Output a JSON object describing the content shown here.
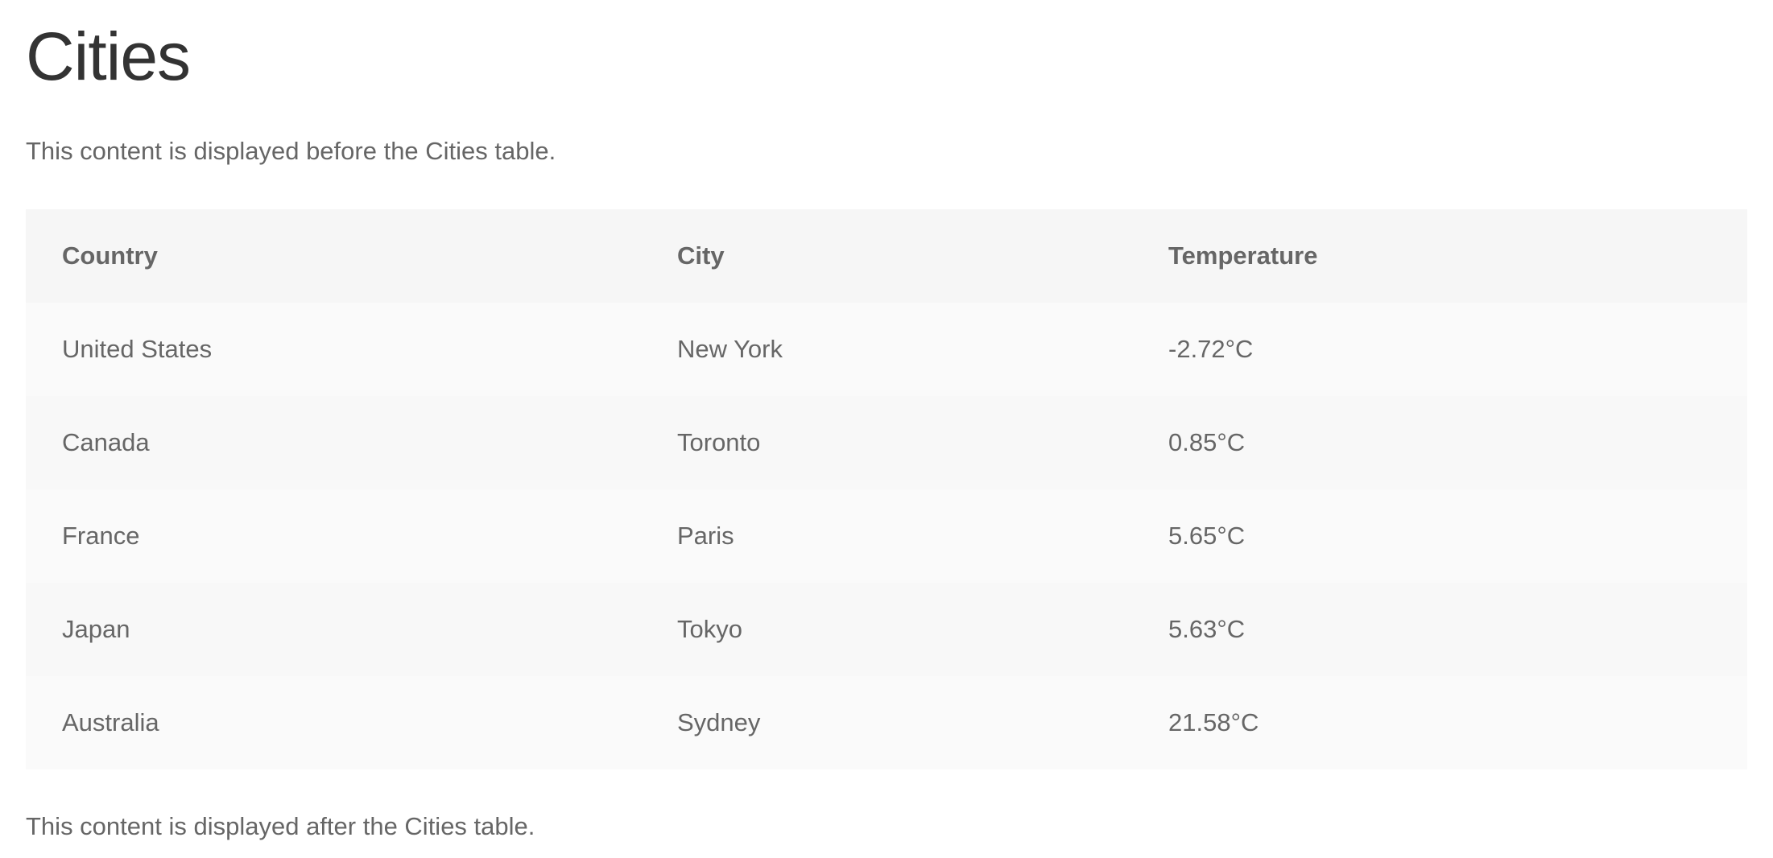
{
  "page": {
    "title": "Cities",
    "intro": "This content is displayed before the Cities table.",
    "outro": "This content is displayed after the Cities table."
  },
  "table": {
    "headers": [
      "Country",
      "City",
      "Temperature"
    ],
    "rows": [
      [
        "United States",
        "New York",
        "-2.72°C"
      ],
      [
        "Canada",
        "Toronto",
        "0.85°C"
      ],
      [
        "France",
        "Paris",
        "5.65°C"
      ],
      [
        "Japan",
        "Tokyo",
        "5.63°C"
      ],
      [
        "Australia",
        "Sydney",
        "21.58°C"
      ]
    ]
  },
  "colors": {
    "title": "#333333",
    "text": "#666666",
    "header_bg": "#f6f6f6",
    "row_bg": "#fafafa"
  }
}
